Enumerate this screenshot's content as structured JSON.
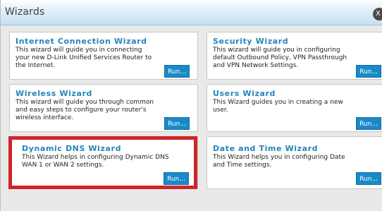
{
  "dialog": {
    "title": "Wizards",
    "close_label": "X"
  },
  "wizards": [
    {
      "title": "Internet Connection Wizard",
      "description": "This wizard will guide you in connecting\nyour new D-Link Unified Services Router to\nthe Internet.",
      "run_label": "Run..."
    },
    {
      "title": "Security Wizard",
      "description": "This wizard will guide you in configuring\ndefault Outbound Policy, VPN Passthrough\nand VPN Network Settings.",
      "run_label": "Run..."
    },
    {
      "title": "Wireless Wizard",
      "description": "This wizard will guide you through common\nand easy steps to configure your router's\nwireless interface.",
      "run_label": "Run..."
    },
    {
      "title": "Users Wizard",
      "description": "This Wizard guides you in creating a new\nuser.",
      "run_label": "Run..."
    },
    {
      "title": "Dynamic DNS Wizard",
      "description": "This Wizard helps in configuring Dynamic DNS\nWAN 1 or WAN 2 settings.",
      "run_label": "Run..."
    },
    {
      "title": "Date and Time Wizard",
      "description": "This Wizard helps you in configuring Date\nand Time settings.",
      "run_label": "Run..."
    }
  ],
  "colors": {
    "title_blue": "#2585b8",
    "button_blue": "#1a8ac6",
    "highlight_red": "#d0232a"
  }
}
